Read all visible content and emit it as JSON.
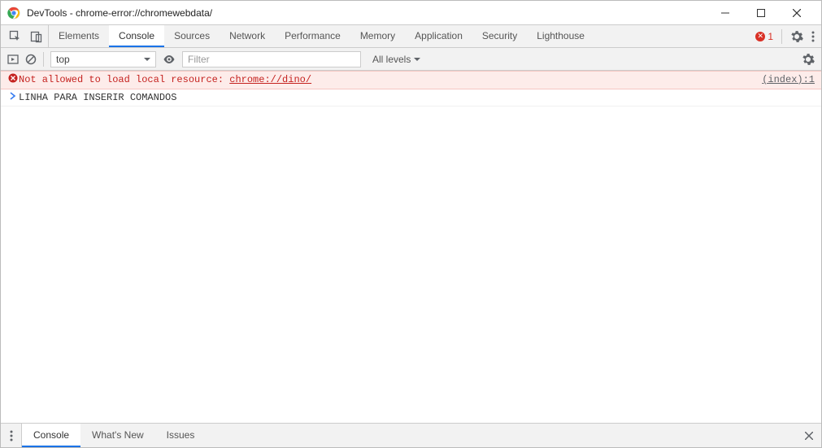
{
  "title": "DevTools - chrome-error://chromewebdata/",
  "tabs": [
    "Elements",
    "Console",
    "Sources",
    "Network",
    "Performance",
    "Memory",
    "Application",
    "Security",
    "Lighthouse"
  ],
  "active_tab": "Console",
  "error_count": "1",
  "toolbar": {
    "context": "top",
    "filter_placeholder": "Filter",
    "levels_label": "All levels"
  },
  "messages": [
    {
      "type": "error",
      "text": "Not allowed to load local resource: ",
      "link": "chrome://dino/",
      "source": "(index):1"
    },
    {
      "type": "prompt",
      "text": "LINHA PARA INSERIR COMANDOS"
    }
  ],
  "drawer_tabs": [
    "Console",
    "What's New",
    "Issues"
  ],
  "drawer_active": "Console"
}
